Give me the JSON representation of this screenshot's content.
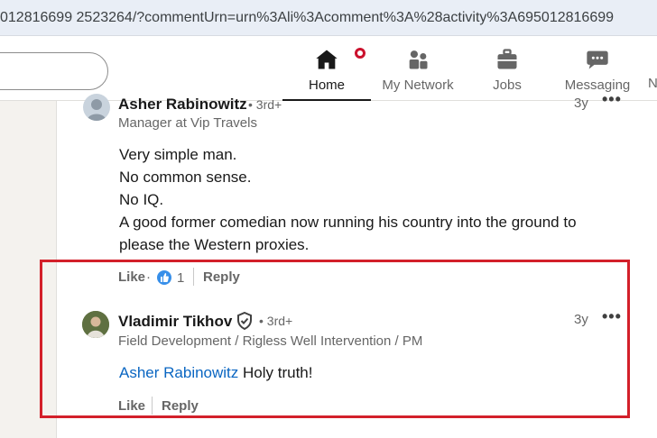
{
  "browser": {
    "url": "012816699 2523264/?commentUrn=urn%3Ali%3Acomment%3A%28activity%3A695012816699"
  },
  "nav": {
    "items": [
      {
        "label": "Home",
        "icon": "home-icon",
        "active": true
      },
      {
        "label": "My Network",
        "icon": "people-icon"
      },
      {
        "label": "Jobs",
        "icon": "briefcase-icon"
      },
      {
        "label": "Messaging",
        "icon": "chat-icon"
      },
      {
        "label": "N"
      }
    ]
  },
  "comment": {
    "author": "Asher Rabinowitz",
    "degree": "• 3rd+",
    "headline": "Manager at Vip Travels",
    "time": "3y",
    "body": [
      "Very simple man.",
      "No common sense.",
      "No IQ.",
      "A good former comedian now running his country into the ground to",
      "please the Western proxies."
    ],
    "actions": {
      "like": "Like",
      "dot": "·",
      "like_count": "1",
      "reply": "Reply"
    }
  },
  "reply": {
    "author": "Vladimir Tikhov",
    "degree": "• 3rd+",
    "headline": "Field Development / Rigless Well Intervention / PM",
    "time": "3y",
    "mention": "Asher Rabinowitz",
    "text": " Holy truth!",
    "actions": {
      "like": "Like",
      "reply": "Reply"
    }
  },
  "colors": {
    "highlight_border": "#d3202a",
    "link": "#0a66c2",
    "badge": "#cb112d"
  }
}
